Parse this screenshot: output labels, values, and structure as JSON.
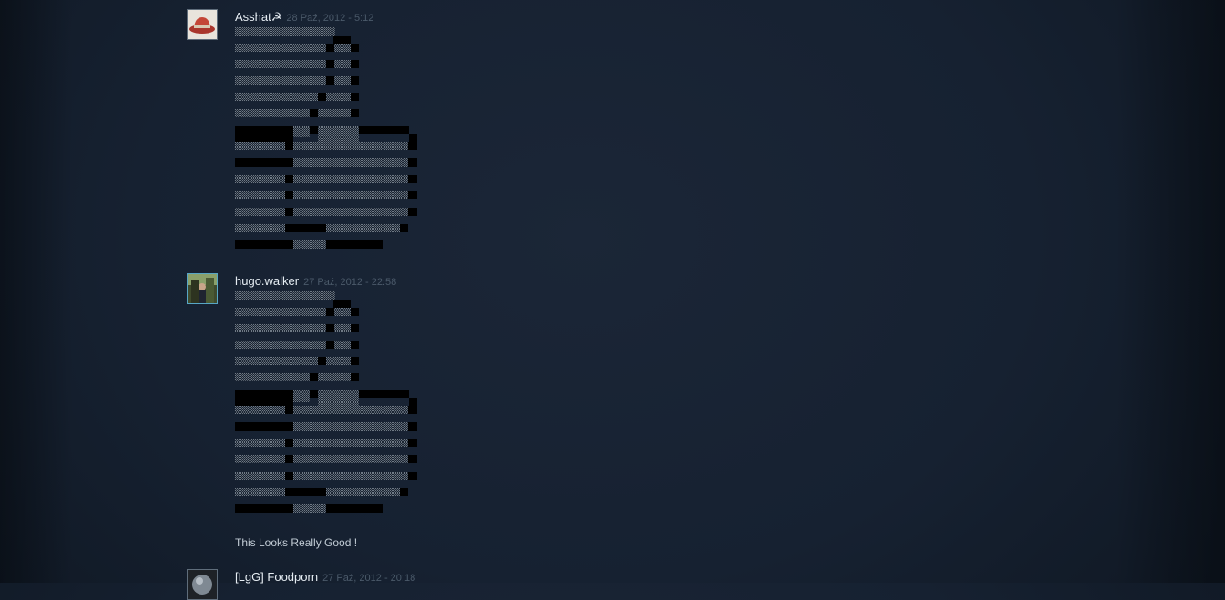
{
  "comments": [
    {
      "author": "Asshat☭",
      "timestamp": "28 Paź, 2012 - 5:12",
      "avatar_icon": "red-hat-avatar-icon",
      "text": ""
    },
    {
      "author": "hugo.walker",
      "timestamp": "27 Paź, 2012 - 22:58",
      "avatar_icon": "photo-avatar-icon",
      "text": "This Looks Really Good !"
    },
    {
      "author": "[LgG] Foodporn",
      "timestamp": "27 Paź, 2012 - 20:18",
      "avatar_icon": "globe-avatar-icon",
      "text": ""
    }
  ],
  "colors": {
    "background": "#162131",
    "ascii_light": "#aeb6be",
    "ascii_dark": "#3b4655",
    "author": "#e6edf3",
    "timestamp": "#4b5a6a"
  }
}
